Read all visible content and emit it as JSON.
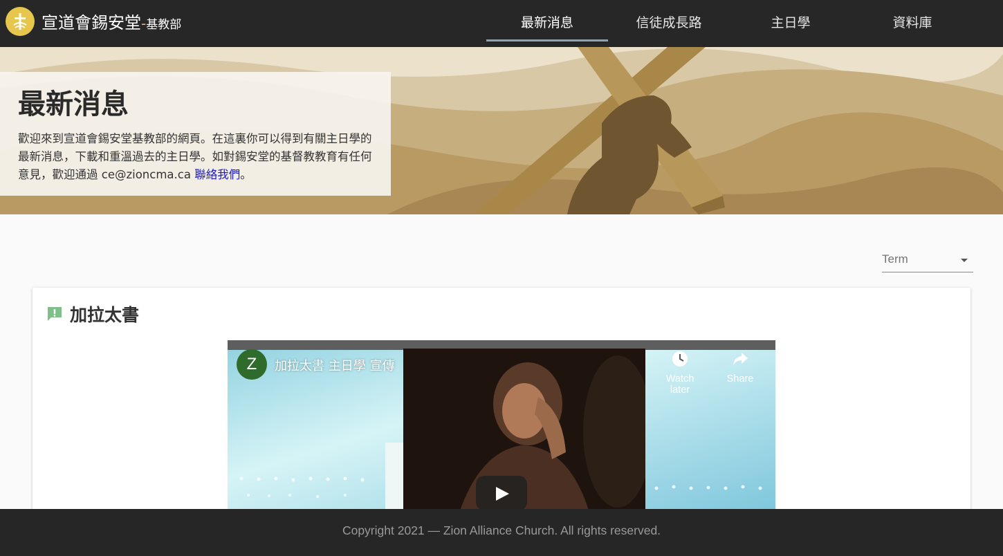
{
  "header": {
    "brand_main": "宣道會錫安堂",
    "brand_dash": "-",
    "brand_sub": "基教部"
  },
  "nav": {
    "items": [
      {
        "label": "最新消息",
        "active": true
      },
      {
        "label": "信徒成長路",
        "active": false
      },
      {
        "label": "主日學",
        "active": false
      },
      {
        "label": "資料庫",
        "active": false
      }
    ]
  },
  "hero": {
    "title": "最新消息",
    "text_before_link": "歡迎來到宣道會錫安堂基教部的網頁。在這裏你可以得到有關主日學的最新消息，下載和重溫過去的主日學。如對錫安堂的基督教教育有任何意見，歡迎通過 ce@zioncma.ca ",
    "link_text": "聯絡我們",
    "text_after_link": "。"
  },
  "filter": {
    "term_label": "Term"
  },
  "card": {
    "title": "加拉太書",
    "video": {
      "channel_initial": "Z",
      "title": "加拉太書 主日學 宣傳",
      "watch_later": "Watch later",
      "share": "Share"
    }
  },
  "footer": {
    "copyright": "Copyright 2021 — Zion Alliance Church. All rights reserved."
  },
  "colors": {
    "topbar": "#272727",
    "nav_active_underline": "#8aa3b8",
    "logo": "#e6c64d",
    "link": "#1a1ad6",
    "card_icon": "#7fc08a",
    "footer": "#262626"
  },
  "icons": [
    "cross-logo-icon",
    "feedback-icon",
    "clock-icon",
    "share-icon",
    "play-icon",
    "chevron-down-icon"
  ]
}
